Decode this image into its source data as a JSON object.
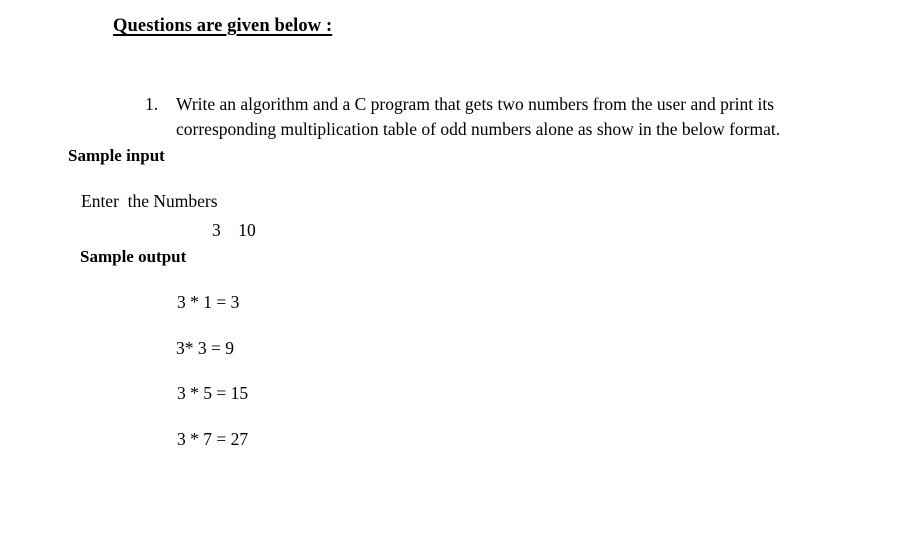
{
  "document": {
    "title": "Questions are given below :",
    "questions": [
      {
        "marker": "1.",
        "text": "Write an algorithm and a C program that gets two numbers from the user and print its corresponding multiplication table of odd numbers alone as show in the below format."
      }
    ],
    "sample_input": {
      "label": "Sample input",
      "prompt": "Enter  the Numbers",
      "values": "3    10"
    },
    "sample_output": {
      "label": "Sample output",
      "lines": [
        "3 * 1 = 3",
        "3* 3 = 9",
        "3 * 5 = 15",
        "3 * 7 = 27"
      ]
    }
  },
  "colors": {
    "page_background": "#ffffff",
    "text": "#000000"
  }
}
